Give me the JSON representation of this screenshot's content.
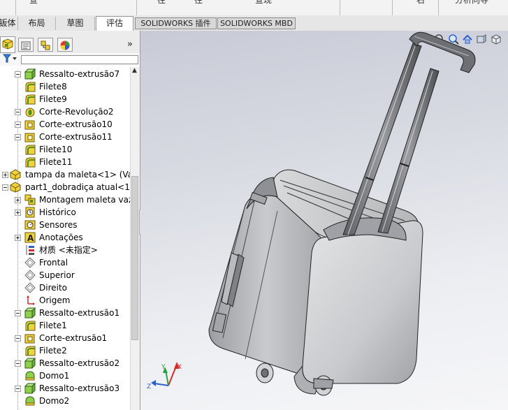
{
  "top_strip": {
    "fragments": [
      "查",
      "往",
      "往",
      "查现",
      "右",
      "分析向导"
    ]
  },
  "tabs": [
    {
      "label": "钣体",
      "active": false
    },
    {
      "label": "布局",
      "active": false
    },
    {
      "label": "草图",
      "active": false
    },
    {
      "label": "评估",
      "active": true
    },
    {
      "label": "SOLIDWORKS 插件",
      "active": false
    },
    {
      "label": "SOLIDWORKS MBD",
      "active": false
    }
  ],
  "panel": {
    "expand_label": "»"
  },
  "tree": [
    {
      "label": "Ressalto-extrusão7",
      "icon": "boss-extrude-icon",
      "expander": "minus"
    },
    {
      "label": "Filete8",
      "icon": "fillet-icon",
      "expander": "none"
    },
    {
      "label": "Filete9",
      "icon": "fillet-icon",
      "expander": "none"
    },
    {
      "label": "Corte-Revolução2",
      "icon": "revolve-cut-icon",
      "expander": "minus"
    },
    {
      "label": "Corte-extrusão10",
      "icon": "cut-extrude-icon",
      "expander": "minus"
    },
    {
      "label": "Corte-extrusão11",
      "icon": "cut-extrude-icon",
      "expander": "minus"
    },
    {
      "label": "Filete10",
      "icon": "fillet-icon",
      "expander": "none"
    },
    {
      "label": "Filete11",
      "icon": "fillet-icon",
      "expander": "none"
    },
    {
      "label": "tampa da maleta<1> (Va",
      "icon": "part-icon",
      "expander": "plus"
    },
    {
      "label": "part1_dobradiça atual<1:",
      "icon": "part-icon",
      "expander": "minus"
    },
    {
      "label": "Montagem maleta vaz",
      "icon": "assembly-icon",
      "expander": "plus"
    },
    {
      "label": "Histórico",
      "icon": "history-icon",
      "expander": "plus"
    },
    {
      "label": "Sensores",
      "icon": "sensor-icon",
      "expander": "none"
    },
    {
      "label": "Anotações",
      "icon": "annotation-icon",
      "expander": "plus"
    },
    {
      "label": "材质 <未指定>",
      "icon": "material-icon",
      "expander": "none"
    },
    {
      "label": "Frontal",
      "icon": "plane-icon",
      "expander": "none"
    },
    {
      "label": "Superior",
      "icon": "plane-icon",
      "expander": "none"
    },
    {
      "label": "Direito",
      "icon": "plane-icon",
      "expander": "none"
    },
    {
      "label": "Origem",
      "icon": "origin-icon",
      "expander": "none"
    },
    {
      "label": "Ressalto-extrusão1",
      "icon": "boss-extrude-icon",
      "expander": "minus"
    },
    {
      "label": "Filete1",
      "icon": "fillet-icon",
      "expander": "none"
    },
    {
      "label": "Corte-extrusão1",
      "icon": "cut-extrude-icon",
      "expander": "minus"
    },
    {
      "label": "Filete2",
      "icon": "fillet-icon",
      "expander": "none"
    },
    {
      "label": "Ressalto-extrusão2",
      "icon": "boss-extrude-icon",
      "expander": "minus"
    },
    {
      "label": "Domo1",
      "icon": "dome-icon",
      "expander": "none"
    },
    {
      "label": "Ressalto-extrusão3",
      "icon": "boss-extrude-icon",
      "expander": "minus"
    },
    {
      "label": "Domo2",
      "icon": "dome-icon",
      "expander": "none"
    }
  ],
  "colors": {
    "feature_green": "#8fd14f",
    "feature_yellow": "#f1d23a",
    "viewport_top": "#c8cad6"
  },
  "triad": {
    "x": "X",
    "y": "Y",
    "z": "Z"
  }
}
